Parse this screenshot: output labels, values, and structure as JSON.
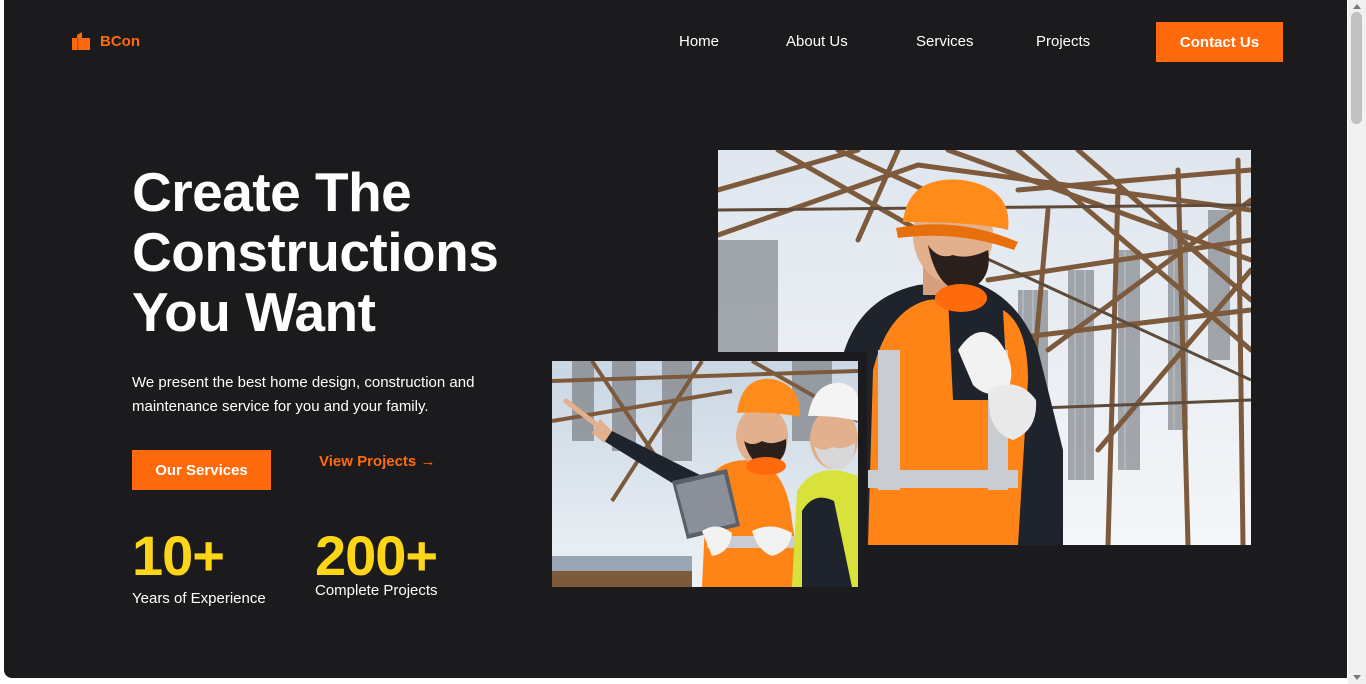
{
  "nav": {
    "logo_text": "BCon",
    "links": [
      "Home",
      "About Us",
      "Services",
      "Projects"
    ],
    "contact_label": "Contact Us"
  },
  "hero": {
    "title_lines": [
      "Create The",
      "Constructions",
      "You Want"
    ],
    "description": "We present the best home design, construction and maintenance service for you and your family.",
    "primary_button": "Our Services",
    "secondary_link": "View Projects →"
  },
  "stats": [
    {
      "value": "10+",
      "label": "Years of Experience"
    },
    {
      "value": "200+",
      "label": "Complete Projects"
    }
  ],
  "colors": {
    "background": "#1b1a1c",
    "accent": "#ff6a0c",
    "stat": "#ffd617",
    "text": "#ffffff"
  },
  "icons": {
    "logo": "building-icon"
  }
}
